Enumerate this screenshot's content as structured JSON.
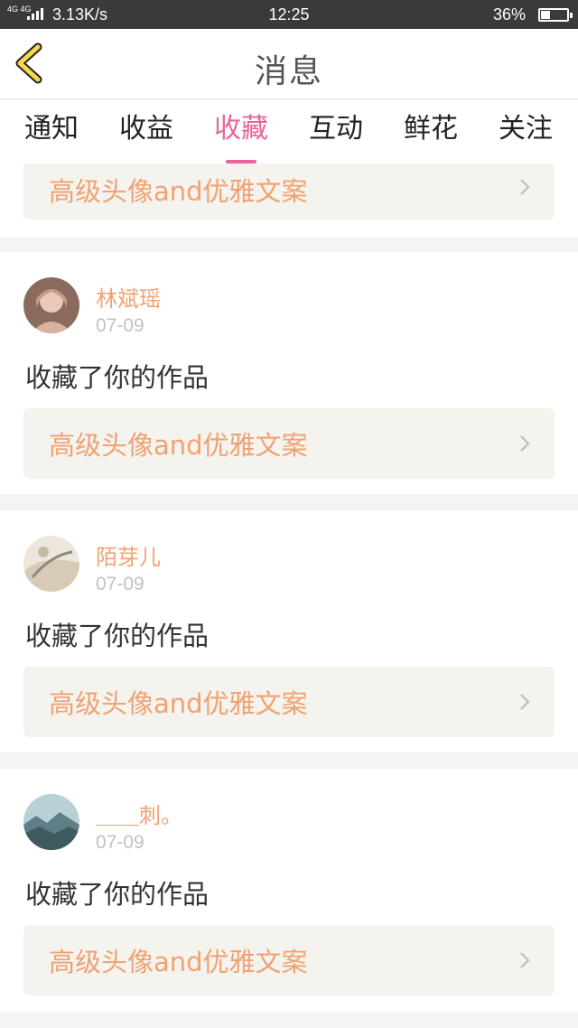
{
  "status_bar": {
    "network": "4G 4G",
    "speed": "3.13K/s",
    "time": "12:25",
    "battery": "36%",
    "battery_level": 0.36
  },
  "nav": {
    "title": "消息",
    "back_icon": "chevron-left-icon"
  },
  "tabs": [
    {
      "label": "通知",
      "active": false
    },
    {
      "label": "收益",
      "active": false
    },
    {
      "label": "收藏",
      "active": true
    },
    {
      "label": "互动",
      "active": false
    },
    {
      "label": "鲜花",
      "active": false
    },
    {
      "label": "关注",
      "active": false
    }
  ],
  "colors": {
    "accent": "#e8649b",
    "name": "#f0a273",
    "work_bg": "#f4f3ee"
  },
  "top_partial": {
    "work_title": "高级头像and优雅文案"
  },
  "messages": [
    {
      "user": "林斌瑶",
      "date": "07-09",
      "action": "收藏了你的作品",
      "work_title": "高级头像and优雅文案"
    },
    {
      "user": "陌芽儿",
      "date": "07-09",
      "action": "收藏了你的作品",
      "work_title": "高级头像and优雅文案"
    },
    {
      "user": "＿＿刺。",
      "date": "07-09",
      "action": "收藏了你的作品",
      "work_title": "高级头像and优雅文案"
    }
  ]
}
